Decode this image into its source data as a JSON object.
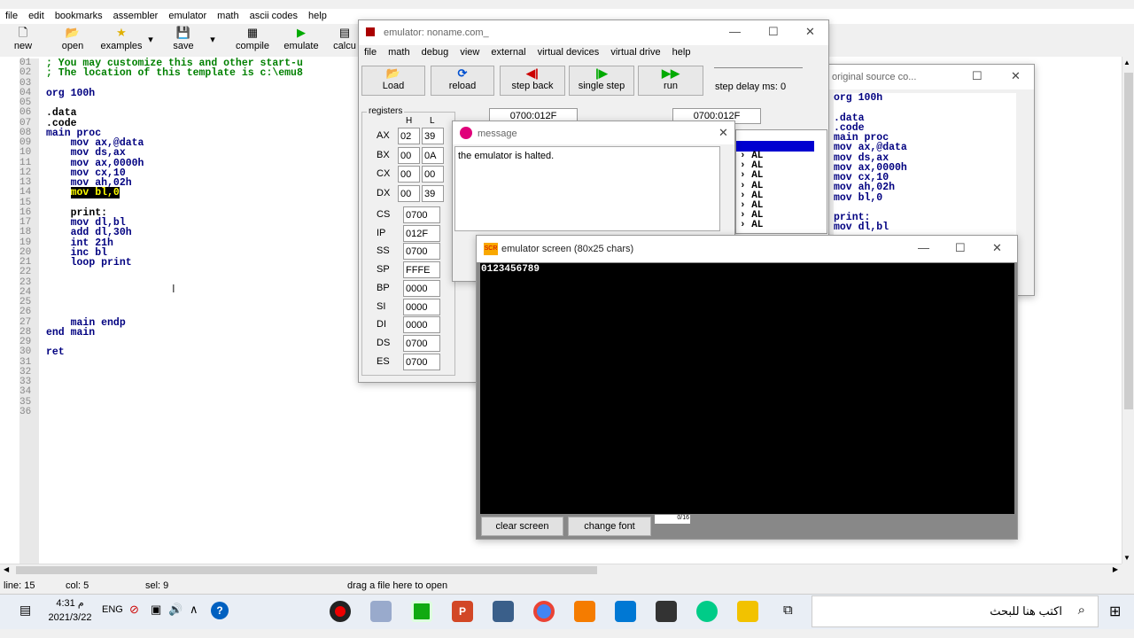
{
  "menubar": [
    "file",
    "edit",
    "bookmarks",
    "assembler",
    "emulator",
    "math",
    "ascii codes",
    "help"
  ],
  "toolbar": {
    "new": "new",
    "open": "open",
    "examples": "examples",
    "save": "save",
    "compile": "compile",
    "emulate": "emulate",
    "calc": "calcu"
  },
  "editor": {
    "line_numbers": [
      "01",
      "02",
      "03",
      "04",
      "05",
      "06",
      "07",
      "08",
      "09",
      "10",
      "11",
      "12",
      "13",
      "14",
      "15",
      "16",
      "17",
      "18",
      "19",
      "20",
      "21",
      "22",
      "23",
      "24",
      "25",
      "26",
      "27",
      "28",
      "29",
      "30",
      "31",
      "32",
      "33",
      "34",
      "35",
      "36"
    ],
    "comment1": "; You may customize this and other start-u",
    "comment2": "; The location of this template is c:\\emu8",
    "org": "org 100h",
    "data": ".data",
    "codeseg": ".code",
    "main_proc": "main proc",
    "l10": "mov ax,@data",
    "l11": "mov ds,ax",
    "l12": "mov ax,0000h",
    "l13": "mov cx,10",
    "l14": "mov ah,02h",
    "l15": "mov bl,0",
    "l17": "print:",
    "l18": "mov dl,bl",
    "l19": "add dl,30h",
    "l20": "int 21h",
    "l21": "inc bl",
    "l22": "loop print",
    "l28": "main endp",
    "l29": "end main",
    "l31": "ret"
  },
  "status": {
    "line": "line: 15",
    "col": "col: 5",
    "sel": "sel: 9",
    "drop": "drag a file here to open"
  },
  "emulator": {
    "title": "emulator: noname.com_",
    "menu": [
      "file",
      "math",
      "debug",
      "view",
      "external",
      "virtual devices",
      "virtual drive",
      "help"
    ],
    "buttons": {
      "load": "Load",
      "reload": "reload",
      "step_back": "step back",
      "single_step": "single step",
      "run": "run"
    },
    "step_delay": "step delay ms: 0",
    "addr1": "0700:012F",
    "addr2": "0700:012F",
    "registers_label": "registers",
    "h_label": "H",
    "l_label": "L",
    "regs": [
      {
        "name": "AX",
        "h": "02",
        "l": "39"
      },
      {
        "name": "BX",
        "h": "00",
        "l": "0A"
      },
      {
        "name": "CX",
        "h": "00",
        "l": "00"
      },
      {
        "name": "DX",
        "h": "00",
        "l": "39"
      }
    ],
    "segs": [
      {
        "name": "CS",
        "v": "0700"
      },
      {
        "name": "IP",
        "v": "012F"
      },
      {
        "name": "SS",
        "v": "0700"
      },
      {
        "name": "SP",
        "v": "FFFE"
      },
      {
        "name": "BP",
        "v": "0000"
      },
      {
        "name": "SI",
        "v": "0000"
      },
      {
        "name": "DI",
        "v": "0000"
      },
      {
        "name": "DS",
        "v": "0700"
      },
      {
        "name": "ES",
        "v": "0700"
      }
    ],
    "dis_al": "AL"
  },
  "source_window": {
    "title": "original source co...",
    "lines": [
      "org 100h",
      "",
      ".data",
      ".code",
      "main proc",
      "mov ax,@data",
      "mov ds,ax",
      "mov ax,0000h",
      "mov cx,10",
      "mov ah,02h",
      "mov bl,0",
      "",
      "print:",
      "mov dl,bl"
    ]
  },
  "message": {
    "title": "message",
    "text": "the emulator is halted."
  },
  "screen": {
    "title": "emulator screen (80x25 chars)",
    "output": "0123456789",
    "clear": "clear screen",
    "font": "change font",
    "counter": "0/16"
  },
  "taskbar": {
    "time": "4:31 م",
    "date": "2021/3/22",
    "lang": "ENG",
    "search": "اكتب هنا للبحث"
  }
}
